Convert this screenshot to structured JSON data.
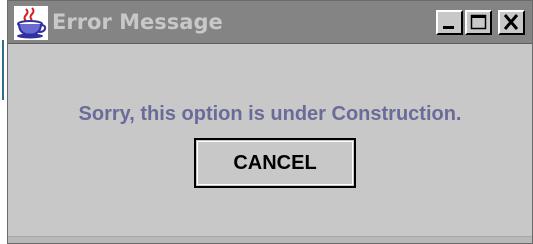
{
  "window": {
    "title": "Error Message",
    "app_icon": "java-coffee-cup-icon",
    "controls": {
      "minimize": "minimize-icon",
      "maximize": "maximize-icon",
      "close": "close-icon"
    }
  },
  "dialog": {
    "message": "Sorry, this option is under Construction.",
    "cancel_label": "CANCEL"
  },
  "colors": {
    "titlebar": "#848484",
    "title_text": "#c8c8c8",
    "background": "#c8c8c8",
    "message_text": "#6b6b9a"
  }
}
